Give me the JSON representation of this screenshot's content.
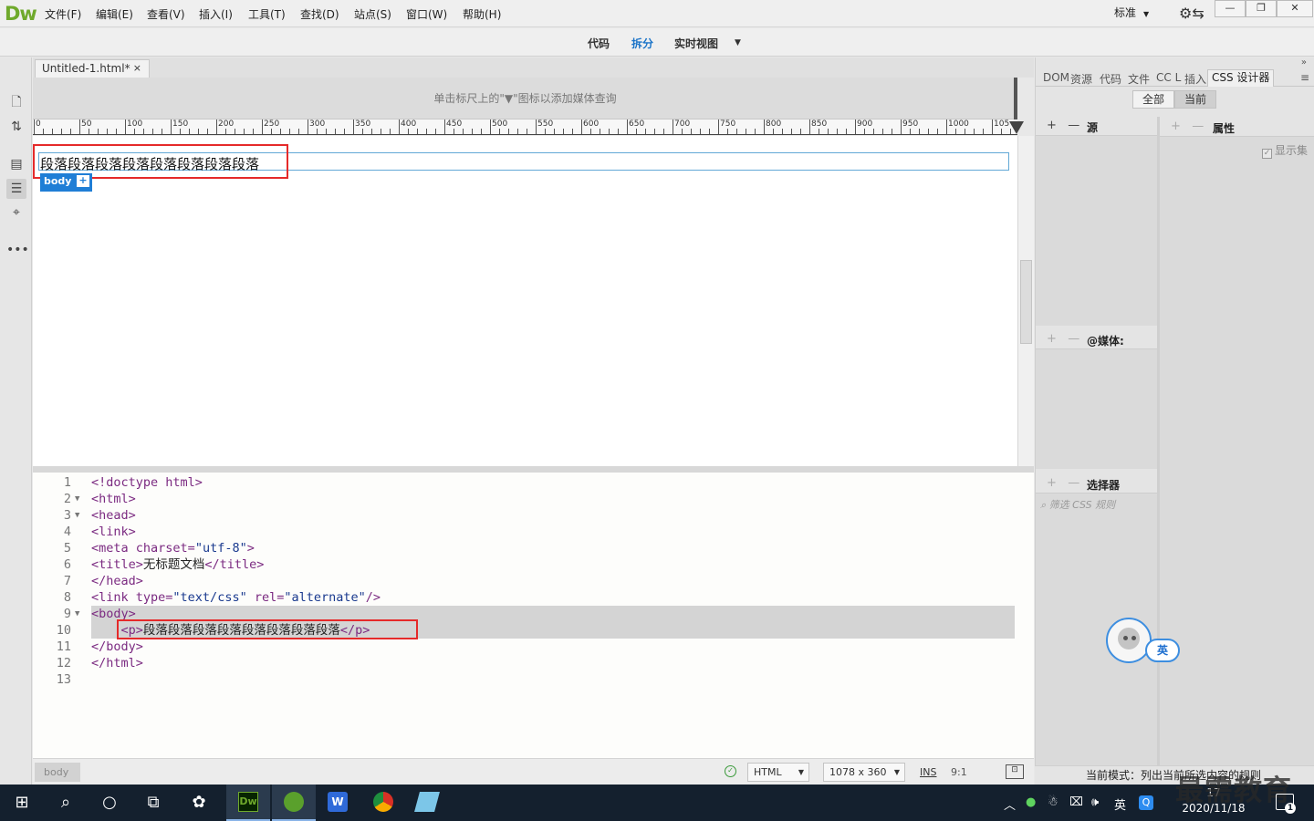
{
  "app": {
    "logo": "Dw"
  },
  "menu": [
    "文件(F)",
    "编辑(E)",
    "查看(V)",
    "插入(I)",
    "工具(T)",
    "查找(D)",
    "站点(S)",
    "窗口(W)",
    "帮助(H)"
  ],
  "workspace_layout": "标准",
  "view_modes": [
    "代码",
    "拆分",
    "实时视图"
  ],
  "active_view": "拆分",
  "document_tab": {
    "title": "Untitled-1.html*",
    "close": "×"
  },
  "media_query_hint": "单击标尺上的\"▼\"图标以添加媒体查询",
  "ruler_labels": [
    "0",
    "50",
    "100",
    "150",
    "200",
    "250",
    "300",
    "350",
    "400",
    "450",
    "500",
    "550",
    "600",
    "650",
    "700",
    "750",
    "800",
    "850",
    "900",
    "950",
    "1000",
    "105"
  ],
  "design": {
    "paragraph_text": "段落段落段落段落段落段落段落段落",
    "body_tag": "body",
    "body_tag_plus": "+"
  },
  "code_lines": [
    {
      "num": "1",
      "fold": "",
      "html": "<span class=\"t\">&lt;!doctype html&gt;</span>"
    },
    {
      "num": "2",
      "fold": "▼",
      "html": "<span class=\"t\">&lt;html&gt;</span>"
    },
    {
      "num": "3",
      "fold": "▼",
      "html": "<span class=\"t\">&lt;head&gt;</span>"
    },
    {
      "num": "4",
      "fold": "",
      "html": "<span class=\"t\">&lt;link&gt;</span>"
    },
    {
      "num": "5",
      "fold": "",
      "html": "<span class=\"t\">&lt;meta </span><span class=\"a\">charset=</span><span class=\"v\">\"utf-8\"</span><span class=\"t\">&gt;</span>"
    },
    {
      "num": "6",
      "fold": "",
      "html": "<span class=\"t\">&lt;title&gt;</span><span class=\"tx\">无标题文档</span><span class=\"t\">&lt;/title&gt;</span>"
    },
    {
      "num": "7",
      "fold": "",
      "html": "<span class=\"t\">&lt;/head&gt;</span>"
    },
    {
      "num": "8",
      "fold": "",
      "html": "<span class=\"t\">&lt;link </span><span class=\"a\">type=</span><span class=\"v\">\"text/css\"</span><span class=\"a\"> rel=</span><span class=\"v\">\"alternate\"</span><span class=\"t\">/&gt;</span>"
    },
    {
      "num": "9",
      "fold": "▼",
      "html": "<span class=\"t\">&lt;body&gt;</span>"
    },
    {
      "num": "10",
      "fold": "",
      "html": "    <span class=\"t\">&lt;p&gt;</span><span class=\"tx\">段落段落段落段落段落段落段落段落</span><span class=\"t\">&lt;/p&gt;</span>"
    },
    {
      "num": "11",
      "fold": "",
      "html": "<span class=\"t\">&lt;/body&gt;</span>"
    },
    {
      "num": "12",
      "fold": "",
      "html": "<span class=\"t\">&lt;/html&gt;</span>"
    },
    {
      "num": "13",
      "fold": "",
      "html": ""
    }
  ],
  "highlighted_lines": [
    "9",
    "10"
  ],
  "status": {
    "tag": "body",
    "doc_type": "HTML",
    "window_size": "1078 x 360",
    "insert_mode": "INS",
    "cursor": "9:1"
  },
  "right_panel": {
    "tabs": [
      "DOM",
      "资源",
      "代码",
      "文件",
      "CC L",
      "插入",
      "CSS 设计器"
    ],
    "active_tab": "CSS 设计器",
    "toggle": [
      "全部",
      "当前"
    ],
    "active_toggle": "当前",
    "sections": {
      "sources": "源",
      "media": "@媒体:",
      "selectors": "选择器",
      "properties": "属性"
    },
    "show_set": "显示集",
    "filter_placeholder": "筛选 CSS 规则",
    "status_text": "当前模式：列出当前所选内容的规则"
  },
  "chat": {
    "pill_text": "英"
  },
  "taskbar": {
    "ime": "英",
    "time": "17",
    "date": "2020/11/18",
    "notification_count": "1"
  },
  "watermark": "最需教育"
}
